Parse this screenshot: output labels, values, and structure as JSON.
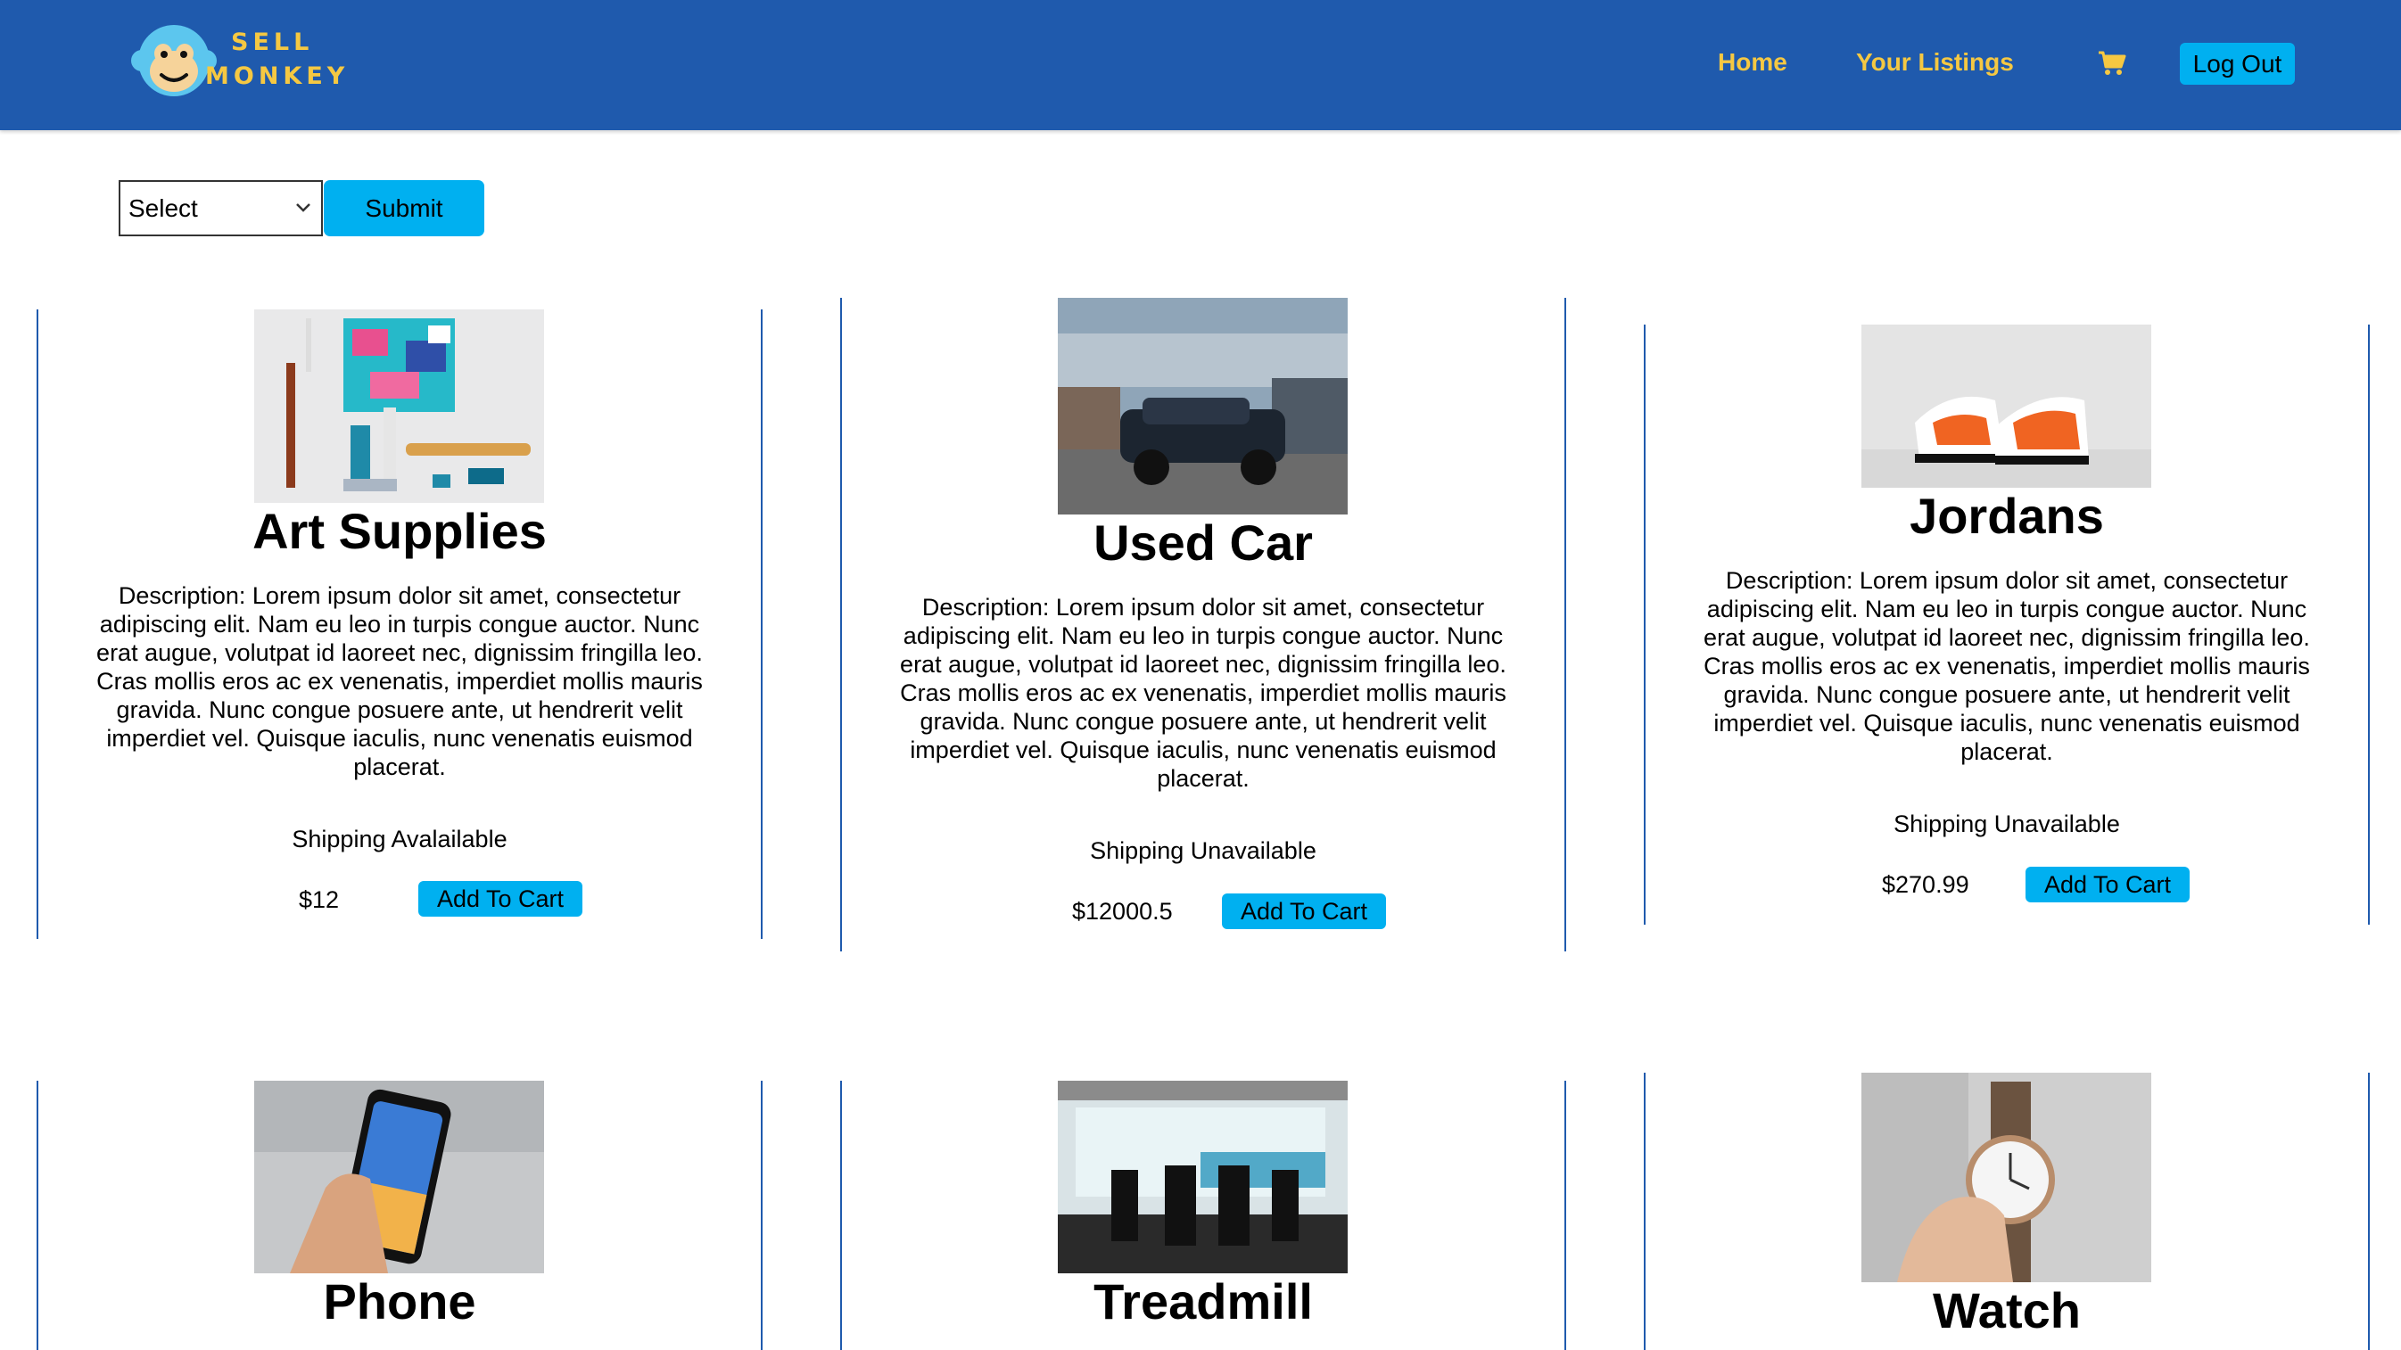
{
  "brand": {
    "line1": "SELL",
    "line2": "MONKEY"
  },
  "nav": {
    "home": "Home",
    "listings": "Your Listings",
    "logout": "Log Out",
    "cart_icon": "shopping-cart-icon"
  },
  "filter": {
    "selected": "Select",
    "submit": "Submit"
  },
  "colors": {
    "navbar": "#1f5aad",
    "accent": "#f5c842",
    "button": "#00b0f0"
  },
  "listings": [
    {
      "title": "Art Supplies",
      "image": "art-supplies-photo",
      "description": "Description: Lorem ipsum dolor sit amet, consectetur adipiscing elit. Nam eu leo in turpis congue auctor. Nunc erat augue, volutpat id laoreet nec, dignissim fringilla leo. Cras mollis eros ac ex venenatis, imperdiet mollis mauris gravida. Nunc congue posuere ante, ut hendrerit velit imperdiet vel. Quisque iaculis, nunc venenatis euismod placerat.",
      "shipping": "Shipping Avalailable",
      "price": "$12",
      "cart_label": "Add To Cart"
    },
    {
      "title": "Used Car",
      "image": "used-car-photo",
      "description": "Description: Lorem ipsum dolor sit amet, consectetur adipiscing elit. Nam eu leo in turpis congue auctor. Nunc erat augue, volutpat id laoreet nec, dignissim fringilla leo. Cras mollis eros ac ex venenatis, imperdiet mollis mauris gravida. Nunc congue posuere ante, ut hendrerit velit imperdiet vel. Quisque iaculis, nunc venenatis euismod placerat.",
      "shipping": "Shipping Unavailable",
      "price": "$12000.5",
      "cart_label": "Add To Cart"
    },
    {
      "title": "Jordans",
      "image": "jordans-photo",
      "description": "Description: Lorem ipsum dolor sit amet, consectetur adipiscing elit. Nam eu leo in turpis congue auctor. Nunc erat augue, volutpat id laoreet nec, dignissim fringilla leo. Cras mollis eros ac ex venenatis, imperdiet mollis mauris gravida. Nunc congue posuere ante, ut hendrerit velit imperdiet vel. Quisque iaculis, nunc venenatis euismod placerat.",
      "shipping": "Shipping Unavailable",
      "price": "$270.99",
      "cart_label": "Add To Cart"
    },
    {
      "title": "Phone",
      "image": "phone-photo"
    },
    {
      "title": "Treadmill",
      "image": "treadmill-photo"
    },
    {
      "title": "Watch",
      "image": "watch-photo"
    }
  ]
}
